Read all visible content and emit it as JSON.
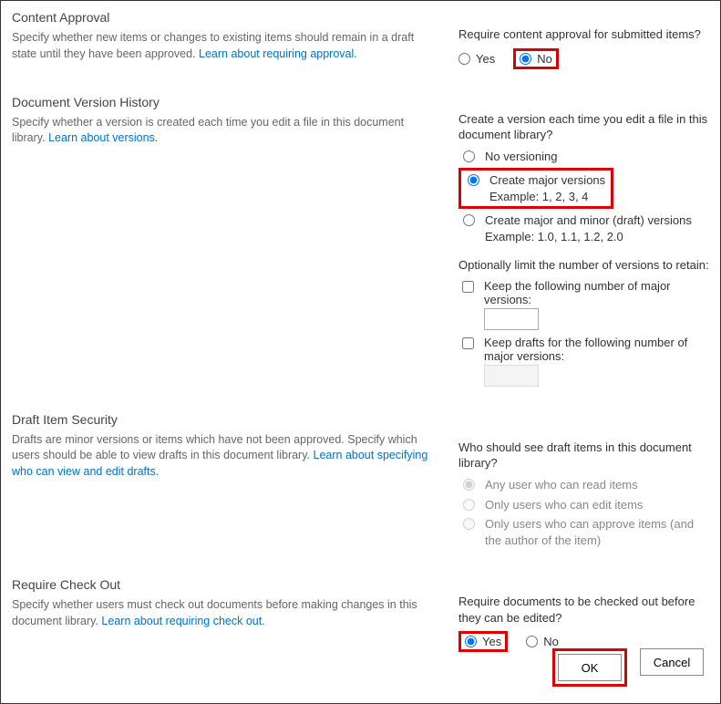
{
  "contentApproval": {
    "title": "Content Approval",
    "desc": "Specify whether new items or changes to existing items should remain in a draft state until they have been approved.  ",
    "link": "Learn about requiring approval.",
    "question": "Require content approval for submitted items?",
    "yes": "Yes",
    "no": "No"
  },
  "versionHistory": {
    "title": "Document Version History",
    "desc": "Specify whether a version is created each time you edit a file in this document library.  ",
    "link": "Learn about versions.",
    "question": "Create a version each time you edit a file in this document library?",
    "opt1": "No versioning",
    "opt2": "Create major versions",
    "opt2ex": "Example: 1, 2, 3, 4",
    "opt3": "Create major and minor (draft) versions",
    "opt3ex": "Example: 1.0, 1.1, 1.2, 2.0",
    "limitLabel": "Optionally limit the number of versions to retain:",
    "chk1": "Keep the following number of major versions:",
    "chk2": "Keep drafts for the following number of major versions:"
  },
  "draftSecurity": {
    "title": "Draft Item Security",
    "desc": "Drafts are minor versions or items which have not been approved. Specify which users should be able to view drafts in this document library.  ",
    "link": "Learn about specifying who can view and edit drafts.",
    "question": "Who should see draft items in this document library?",
    "opt1": "Any user who can read items",
    "opt2": "Only users who can edit items",
    "opt3": "Only users who can approve items (and the author of the item)"
  },
  "checkout": {
    "title": "Require Check Out",
    "desc": "Specify whether users must check out documents before making changes in this document library.  ",
    "link": "Learn about requiring check out.",
    "question": "Require documents to be checked out before they can be edited?",
    "yes": "Yes",
    "no": "No"
  },
  "buttons": {
    "ok": "OK",
    "cancel": "Cancel"
  }
}
